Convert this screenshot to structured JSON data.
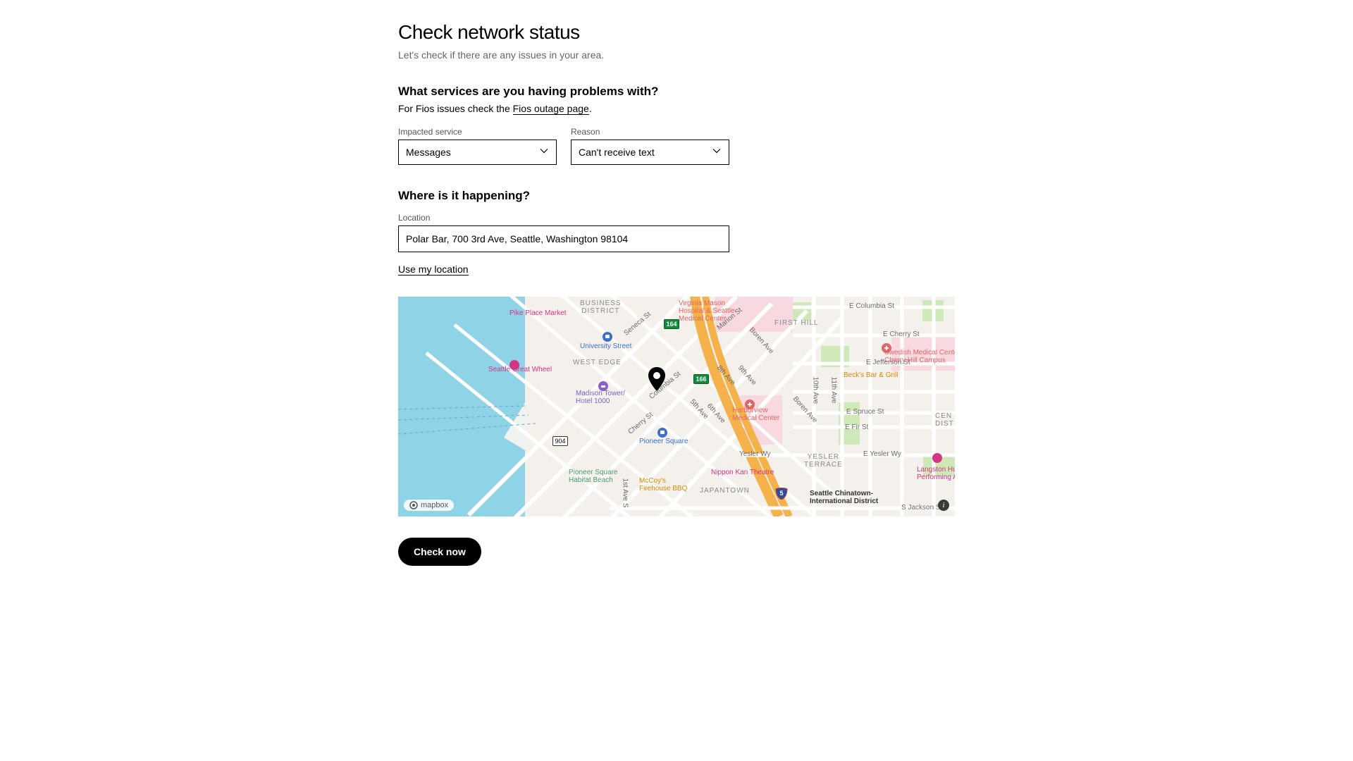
{
  "page": {
    "title": "Check network status",
    "subtitle": "Let's check if there are any issues in your area."
  },
  "services_section": {
    "heading": "What services are you having problems with?",
    "desc_prefix": "For Fios issues check the ",
    "desc_link": "Fios outage page",
    "desc_suffix": ".",
    "impacted_label": "Impacted service",
    "impacted_value": "Messages",
    "reason_label": "Reason",
    "reason_value": "Can't receive text"
  },
  "location_section": {
    "heading": "Where is it happening?",
    "location_label": "Location",
    "location_value": "Polar Bar, 700 3rd Ave, Seattle, Washington 98104",
    "use_my_location": "Use my location"
  },
  "map": {
    "attribution": "mapbox",
    "labels": {
      "business_district": "BUSINESS\nDISTRICT",
      "pike_place": "Pike Place Market",
      "university_st": "University Street",
      "west_edge": "WEST EDGE",
      "great_wheel": "Seattle Great Wheel",
      "madison_tower": "Madison Tower/\nHotel 1000",
      "pioneer_square": "Pioneer Square",
      "pioneer_park": "Pioneer Square\nHabitat Beach",
      "mccoys": "McCoy's\nFirehouse BBQ",
      "japantown": "JAPANTOWN",
      "yesler_wy": "Yesler Wy",
      "yesler_terrace": "YESLER\nTERRACE",
      "chinatown": "Seattle Chinatown-\nInternational District",
      "first_hill": "FIRST HILL",
      "e_columbia": "E Columbia St",
      "e_cherry": "E Cherry St",
      "e_jefferson": "E Jefferson St",
      "e_spruce": "E Spruce St",
      "e_fir": "E Fir St",
      "e_yesler": "E Yesler Wy",
      "s_jackson": "S Jackson St",
      "becks": "Beck's Bar & Grill",
      "swedish": "Swedish Medical Center\nCherry Hill Campus",
      "langston": "Langston Hughes\nPerforming Arts Center",
      "harborview": "Harborview\nMedical Center",
      "vmason": "Virginia Mason\nHospital & Seattle\nMedical Center",
      "nippon": "Nippon Kan Theatre",
      "cen_dist": "CEN\nDIST",
      "seneca": "Seneca St",
      "marion": "Marion St",
      "columbia": "Columbia St",
      "cherry": "Cherry St",
      "first_ave_s": "1st Ave S",
      "fifth": "5th Ave",
      "sixth": "6th Ave",
      "eighth": "8th Ave",
      "ninth": "9th Ave",
      "boren": "Boren Ave",
      "tenth": "10th Ave",
      "eleventh": "11th Ave",
      "hwy164": "164",
      "hwy166": "166",
      "route904": "904",
      "i5": "5"
    }
  },
  "cta": {
    "label": "Check now"
  }
}
